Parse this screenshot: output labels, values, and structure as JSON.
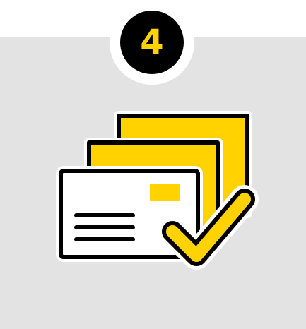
{
  "step": {
    "number": "4"
  },
  "colors": {
    "panel_background": "#e3e3e3",
    "badge_background": "#000000",
    "badge_ring": "#ffffff",
    "badge_text": "#ffd200",
    "accent_yellow": "#ffd200",
    "outline": "#000000",
    "envelope_fill": "#ffffff"
  },
  "icons": {
    "main": "mail-stack-check-icon",
    "parts": [
      "envelope-icon",
      "stamp-icon",
      "checkmark-icon"
    ]
  }
}
